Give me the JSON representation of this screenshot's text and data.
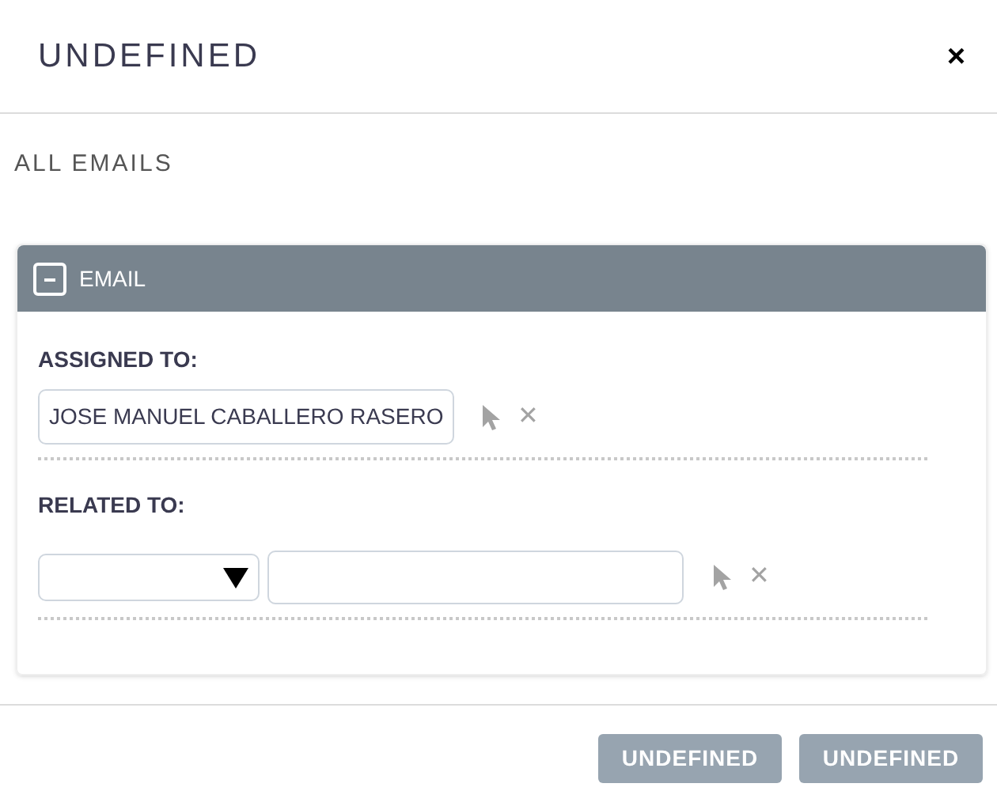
{
  "dialog": {
    "title": "UNDEFINED",
    "close": "×"
  },
  "section_title": "ALL EMAILS",
  "panel": {
    "title": "EMAIL",
    "expanded": true,
    "assigned_to": {
      "label": "ASSIGNED TO:",
      "value": "JOSE MANUEL CABALLERO RASERO",
      "clear": "✕"
    },
    "related_to": {
      "label": "RELATED TO:",
      "clear": "✕"
    }
  },
  "buttons": [
    "UNDEFINED",
    "UNDEFINED"
  ]
}
